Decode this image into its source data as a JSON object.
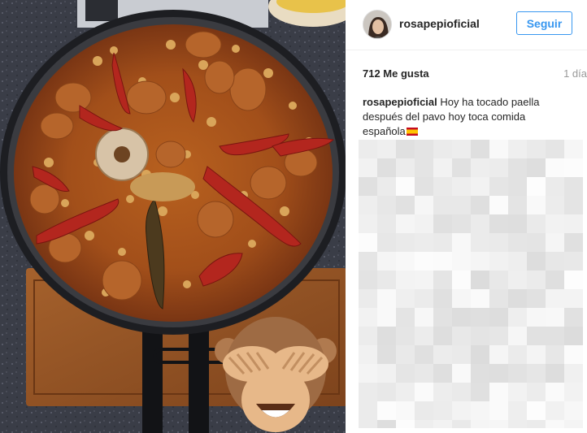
{
  "post": {
    "username": "rosapepioficial",
    "follow_label": "Seguir",
    "likes_label": "712 Me gusta",
    "time_label": "1 día",
    "caption_user": "rosapepioficial",
    "caption_text": "Hoy ha tocado paella después del pavo hoy toca comida española",
    "caption_emoji": "flag-spain-icon"
  },
  "overlay": {
    "emoji": "see-no-evil-monkey-icon"
  },
  "colors": {
    "accent": "#3897f0",
    "text": "#262626",
    "muted": "#999999",
    "divider": "#efefef"
  }
}
